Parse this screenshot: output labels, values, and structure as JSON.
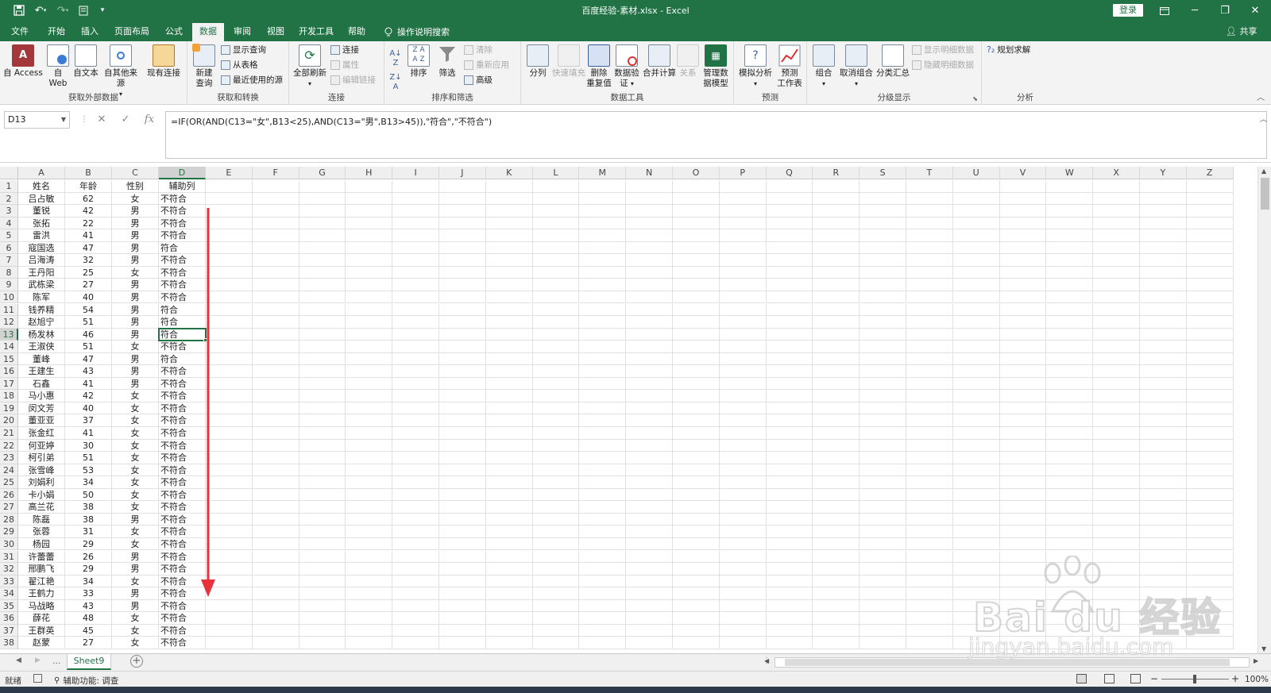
{
  "window": {
    "title": "百度经验-素材.xlsx  -  Excel",
    "login": "登录",
    "share": "共享"
  },
  "tabs": [
    "文件",
    "开始",
    "插入",
    "页面布局",
    "公式",
    "数据",
    "审阅",
    "视图",
    "开发工具",
    "帮助"
  ],
  "active_tab": "数据",
  "tell_me": "操作说明搜索",
  "ribbon": {
    "groups": {
      "get_external": "获取外部数据",
      "get_transform": "获取和转换",
      "connections": "连接",
      "sort_filter": "排序和筛选",
      "data_tools": "数据工具",
      "forecast": "预测",
      "outline": "分级显示",
      "analysis": "分析"
    },
    "buttons": {
      "access": "自 Access",
      "web1": "自",
      "web2": "Web",
      "text": "自文本",
      "other": "自其他来源",
      "existing": "现有连接",
      "newquery1": "新建",
      "newquery2": "查询",
      "showquery": "显示查询",
      "fromtable": "从表格",
      "recent": "最近使用的源",
      "refreshall": "全部刷新",
      "connections": "连接",
      "properties": "属性",
      "editlinks": "编辑链接",
      "sort": "排序",
      "filter": "筛选",
      "clear": "清除",
      "reapply": "重新应用",
      "advanced": "高级",
      "split": "分列",
      "flashfill": "快速填充",
      "removedup1": "删除",
      "removedup2": "重复值",
      "validation1": "数据验",
      "validation2": "证",
      "consolidate": "合并计算",
      "relations": "关系",
      "model1": "管理数",
      "model2": "据模型",
      "whatif": "模拟分析",
      "forecast1": "预测",
      "forecast2": "工作表",
      "group": "组合",
      "ungroup": "取消组合",
      "subtotal": "分类汇总",
      "showdetail": "显示明细数据",
      "hidedetail": "隐藏明细数据",
      "solver": "规划求解"
    }
  },
  "formula_bar": {
    "name_box": "D13",
    "formula": "=IF(OR(AND(C13=\"女\",B13<25),AND(C13=\"男\",B13>45)),\"符合\",\"不符合\")",
    "fx": "fx"
  },
  "columns": [
    "A",
    "B",
    "C",
    "D",
    "E",
    "F",
    "G",
    "H",
    "I",
    "J",
    "K",
    "L",
    "M",
    "N",
    "O",
    "P",
    "Q",
    "R",
    "S",
    "T",
    "U",
    "V",
    "W",
    "X",
    "Y",
    "Z"
  ],
  "rows": [
    [
      "姓名",
      "年龄",
      "性别",
      "辅助列"
    ],
    [
      "吕占敏",
      "62",
      "女",
      "不符合"
    ],
    [
      "董锐",
      "42",
      "男",
      "不符合"
    ],
    [
      "张拓",
      "22",
      "男",
      "不符合"
    ],
    [
      "雷洪",
      "41",
      "男",
      "不符合"
    ],
    [
      "寇国选",
      "47",
      "男",
      "符合"
    ],
    [
      "吕海涛",
      "32",
      "男",
      "不符合"
    ],
    [
      "王丹阳",
      "25",
      "女",
      "不符合"
    ],
    [
      "武栋梁",
      "27",
      "男",
      "不符合"
    ],
    [
      "陈军",
      "40",
      "男",
      "不符合"
    ],
    [
      "钱养精",
      "54",
      "男",
      "符合"
    ],
    [
      "赵旭宁",
      "51",
      "男",
      "符合"
    ],
    [
      "杨发林",
      "46",
      "男",
      "符合"
    ],
    [
      "王淑侠",
      "51",
      "女",
      "不符合"
    ],
    [
      "董峰",
      "47",
      "男",
      "符合"
    ],
    [
      "王建生",
      "43",
      "男",
      "不符合"
    ],
    [
      "石鑫",
      "41",
      "男",
      "不符合"
    ],
    [
      "马小惠",
      "42",
      "女",
      "不符合"
    ],
    [
      "闵文芳",
      "40",
      "女",
      "不符合"
    ],
    [
      "董亚亚",
      "37",
      "女",
      "不符合"
    ],
    [
      "张金红",
      "41",
      "女",
      "不符合"
    ],
    [
      "何亚婷",
      "30",
      "女",
      "不符合"
    ],
    [
      "柯引弟",
      "51",
      "女",
      "不符合"
    ],
    [
      "张雪峰",
      "53",
      "女",
      "不符合"
    ],
    [
      "刘娟利",
      "34",
      "女",
      "不符合"
    ],
    [
      "卡小娟",
      "50",
      "女",
      "不符合"
    ],
    [
      "高兰花",
      "38",
      "女",
      "不符合"
    ],
    [
      "陈磊",
      "38",
      "男",
      "不符合"
    ],
    [
      "张蓉",
      "31",
      "女",
      "不符合"
    ],
    [
      "杨园",
      "29",
      "女",
      "不符合"
    ],
    [
      "许蕾蕾",
      "26",
      "男",
      "不符合"
    ],
    [
      "邢鹏飞",
      "29",
      "男",
      "不符合"
    ],
    [
      "翟江艳",
      "34",
      "女",
      "不符合"
    ],
    [
      "王鹤力",
      "33",
      "男",
      "不符合"
    ],
    [
      "马战略",
      "43",
      "男",
      "不符合"
    ],
    [
      "薛花",
      "48",
      "女",
      "不符合"
    ],
    [
      "王群英",
      "45",
      "女",
      "不符合"
    ],
    [
      "赵蒙",
      "27",
      "女",
      "不符合"
    ]
  ],
  "active_cell": "D13",
  "sheet": {
    "name": "Sheet9",
    "dots": "...",
    "add": "+"
  },
  "status": {
    "ready": "就绪",
    "accessibility": "辅助功能: 调查",
    "zoom": "100%"
  },
  "watermark": {
    "brand": "Bai du 经验",
    "url": "jingyan.baidu.com"
  },
  "colors": {
    "excel_green": "#217346",
    "arrow_red": "#e8323c"
  }
}
